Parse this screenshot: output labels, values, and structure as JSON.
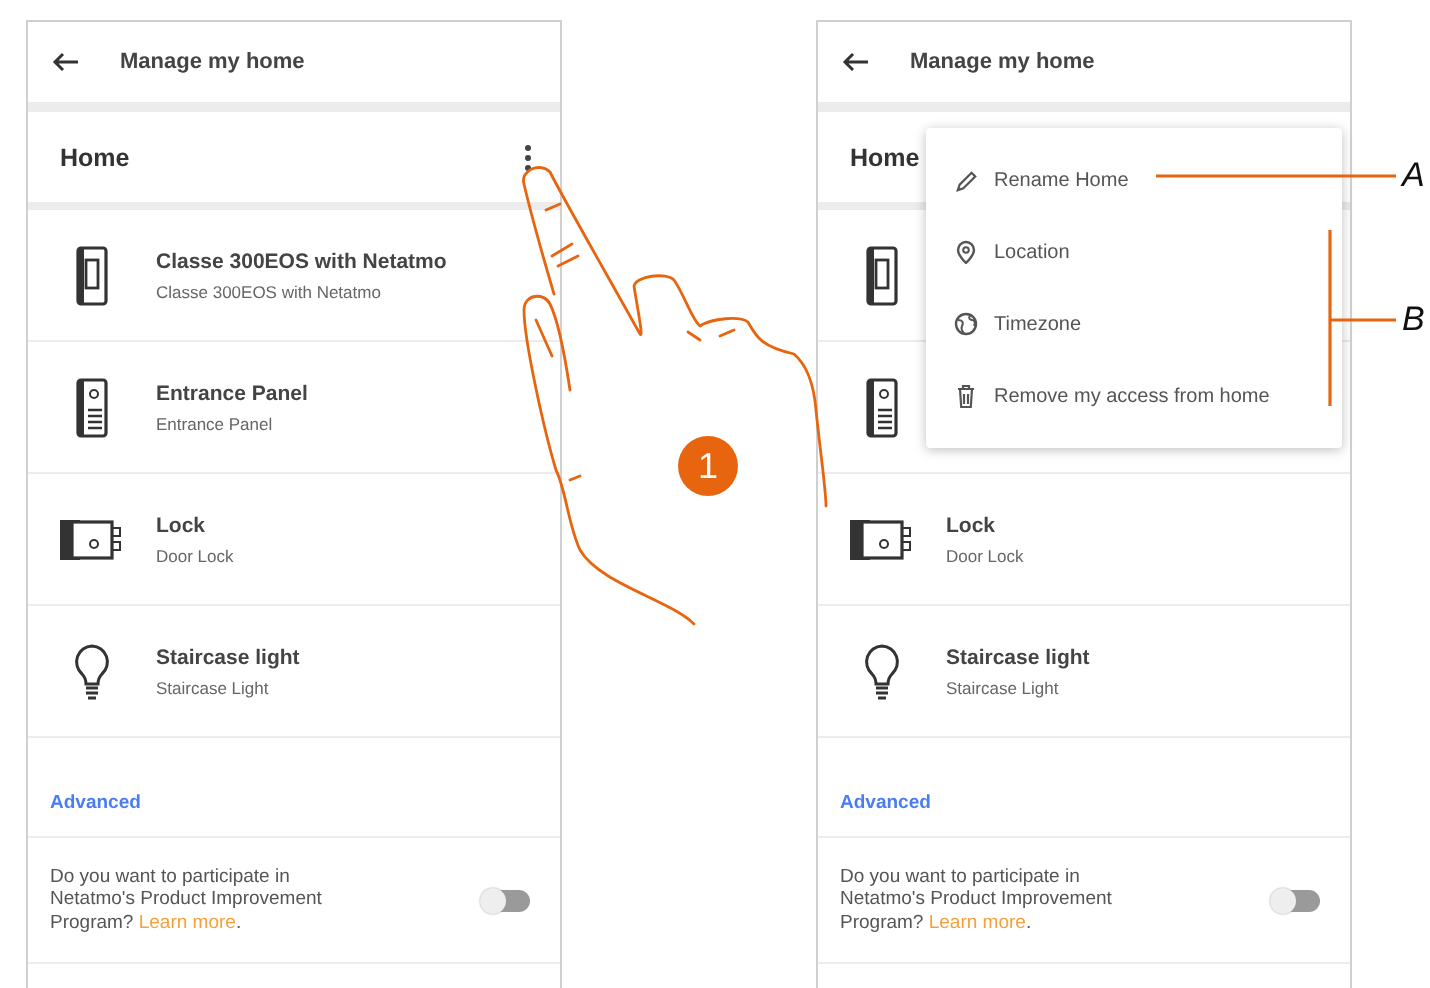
{
  "screens": [
    {
      "title": "Manage my home",
      "home_title": "Home",
      "devices": [
        {
          "name": "Classe 300EOS with Netatmo",
          "subtitle": "Classe 300EOS with Netatmo",
          "kind": "intercom"
        },
        {
          "name": "Entrance Panel",
          "subtitle": "Entrance Panel",
          "kind": "panel"
        },
        {
          "name": "Lock",
          "subtitle": "Door Lock",
          "kind": "lock"
        },
        {
          "name": "Staircase light",
          "subtitle": "Staircase Light",
          "kind": "bulb"
        }
      ],
      "advanced": "Advanced",
      "participation": {
        "text": "Do you want to participate in Netatmo's Product Improvement Program?",
        "link": "Learn more",
        "after": ".",
        "on": false
      }
    },
    {
      "title": "Manage my home",
      "home_title": "Home",
      "devices": [
        {
          "kind": "intercom"
        },
        {
          "kind": "panel"
        },
        {
          "name": "Lock",
          "subtitle": "Door Lock",
          "kind": "lock"
        },
        {
          "name": "Staircase light",
          "subtitle": "Staircase Light",
          "kind": "bulb"
        }
      ],
      "advanced": "Advanced",
      "participation": {
        "text": "Do you want to participate in Netatmo's Product Improvement Program?",
        "link": "Learn more",
        "after": ".",
        "on": false
      },
      "menu": [
        {
          "label": "Rename Home",
          "kind": "edit"
        },
        {
          "label": "Location",
          "kind": "location"
        },
        {
          "label": "Timezone",
          "kind": "globe"
        },
        {
          "label": "Remove my access from home",
          "kind": "trash"
        }
      ]
    }
  ],
  "step_badge": "1",
  "callouts": [
    {
      "label": "A"
    },
    {
      "label": "B"
    }
  ]
}
